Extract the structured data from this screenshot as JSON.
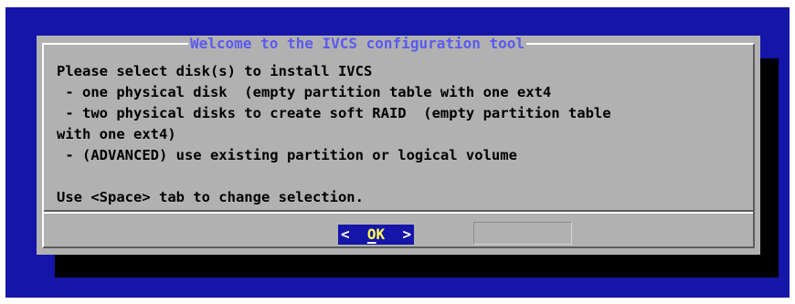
{
  "dialog": {
    "title": "Welcome to the IVCS configuration tool",
    "lines": [
      "Please select disk(s) to install IVCS",
      " - one physical disk  (empty partition table with one ext4",
      " - two physical disks to create soft RAID  (empty partition table",
      "with one ext4)",
      " - (ADVANCED) use existing partition or logical volume",
      "",
      "Use <Space> tab to change selection."
    ],
    "ok_button": {
      "left_bracket": "<",
      "hotkey": "O",
      "label_rest": "K",
      "right_bracket": ">"
    }
  },
  "colors": {
    "screen_background": "#1515a8",
    "dialog_background": "#b1b1b1",
    "title_text": "#5a5af0",
    "button_background": "#1515a8",
    "button_label": "#ffff55",
    "shadow": "#000000"
  }
}
